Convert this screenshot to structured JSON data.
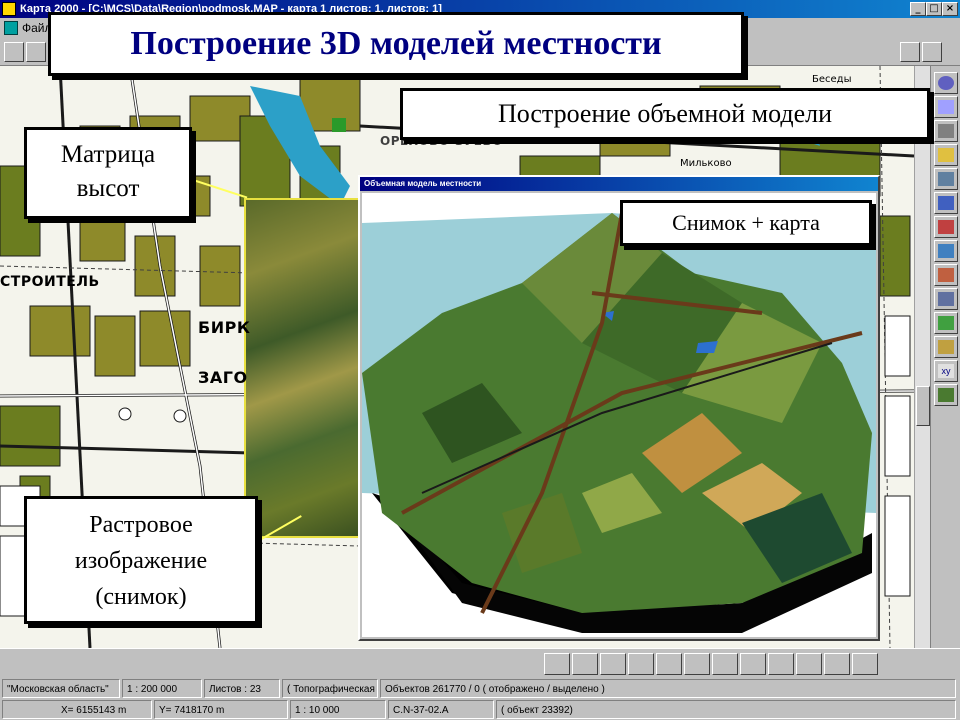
{
  "window": {
    "title": "Карта 2000 - [C:\\MCS\\Data\\Region\\podmosk.MAP - карта 1 листов: 1, листов: 1]",
    "minimize": "_",
    "restore": "□",
    "close": "×"
  },
  "menu": {
    "items": [
      "Файл"
    ]
  },
  "slide": {
    "headline": "Построение 3D моделей местности",
    "callout_volume": "Построение объемной модели",
    "callout_height_matrix": "Матрица высот",
    "callout_raster": "Растровое изображение (снимок)",
    "callout_photo_map": "Снимок + карта"
  },
  "map": {
    "label_stroitel": "СТРОИТЕЛЬ",
    "label_birk": "БИРК",
    "label_zago": "ЗАГО",
    "label_besedy": "Беседы",
    "label_milkovo": "Мильково",
    "label_oreh": "ОРЕХОВО-ЗУЕВО"
  },
  "model_window": {
    "title": "Объемная модель местности"
  },
  "status": {
    "region": "\"Московская область\"",
    "scale": "1 : 200 000",
    "sheets": "Листов : 23",
    "type": "( Топографическая )",
    "objects": "Объектов   261770 / 0 ( отображено / выделено )",
    "x_coord": "X=  6155143 m",
    "y_coord": "Y=  7418170 m",
    "view_scale": "1 : 10 000",
    "sheet_name": "C.N-37-02.A",
    "object_id": "( объект 23392)"
  },
  "colors": {
    "map_green": "#6b7d1f",
    "map_olive": "#8e8a2a",
    "road_black": "#1a1a1a",
    "water_cyan": "#2ca0c8",
    "title_navy": "#000080"
  }
}
